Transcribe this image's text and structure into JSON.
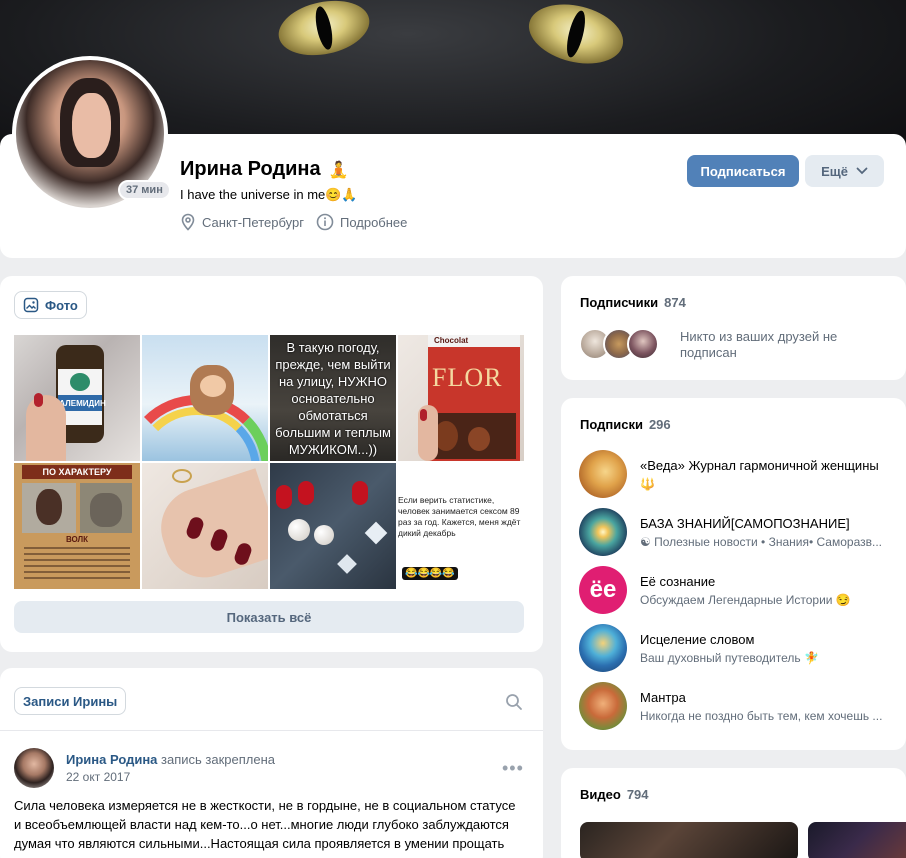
{
  "profile": {
    "name": "Ирина Родина",
    "name_emoji": "🧘",
    "status": "I have the universe in me😊🙏",
    "online_badge": "37 мин",
    "city": "Санкт-Петербург",
    "details_link": "Подробнее",
    "subscribe_button": "Подписаться",
    "more_button": "Ещё"
  },
  "photos": {
    "tab_label": "Фото",
    "show_all": "Показать всё",
    "tiles": [
      {
        "name": "photo-medicine-bottle",
        "text": "ЗАЛЕМИДИН"
      },
      {
        "name": "photo-rainbow-art",
        "text": ""
      },
      {
        "name": "photo-quote-weather",
        "text": "В такую погоду, прежде, чем выйти на улицу, НУЖНО основательно обмотаться большим и теплым МУЖИКОМ...))"
      },
      {
        "name": "photo-chocolate",
        "text": "FLOR"
      },
      {
        "name": "photo-wolf-character",
        "text": "ПО ХАРАКТЕРУ"
      },
      {
        "name": "photo-nails-ring",
        "text": ""
      },
      {
        "name": "photo-nails-pearls",
        "text": ""
      },
      {
        "name": "photo-statistics-text",
        "text": "Если верить статистике, человек занимается сексом 89 раз за год. Кажется, меня ждёт дикий декабрь"
      }
    ],
    "wolf_caption": "ВОЛК",
    "statistics_emojis": "😂😂😂😂",
    "chocolate_label": "Chocolat"
  },
  "posts": {
    "tab_label": "Записи Ирины",
    "author": "Ирина Родина",
    "pinned_note": "запись закреплена",
    "date": "22 окт 2017",
    "text": "Сила человека измеряется не в жесткости, не в гордыне, не в социальном статусе и всеобъемлющей власти над кем-то...о нет...многие люди глубоко заблуждаются думая что являются сильными...Настоящая сила проявляется в умении прощать"
  },
  "subscribers": {
    "title": "Подписчики",
    "count": "874",
    "note": "Никто из ваших друзей не подписан"
  },
  "subscriptions": {
    "title": "Подписки",
    "count": "296",
    "items": [
      {
        "name": "«Веда» Журнал гармоничной женщины",
        "desc": "🔱"
      },
      {
        "name": "БАЗА ЗНАНИЙ[САМОПОЗНАНИЕ]",
        "desc": "☯ Полезные новости • Знания• Саморазв..."
      },
      {
        "name": "Её сознание",
        "desc": "Обсуждаем Легендарные Истории 😏"
      },
      {
        "name": "Исцеление словом",
        "desc": "Ваш духовный путеводитель 🧚"
      },
      {
        "name": "Мантра",
        "desc": "Никогда не поздно быть тем, кем хочешь ..."
      }
    ],
    "ee_logo": "ёе"
  },
  "video": {
    "title": "Видео",
    "count": "794"
  },
  "colors": {
    "accent": "#5181b8",
    "link": "#2a5885",
    "secondary_text": "#626d7a",
    "page_bg": "#edeef0"
  }
}
